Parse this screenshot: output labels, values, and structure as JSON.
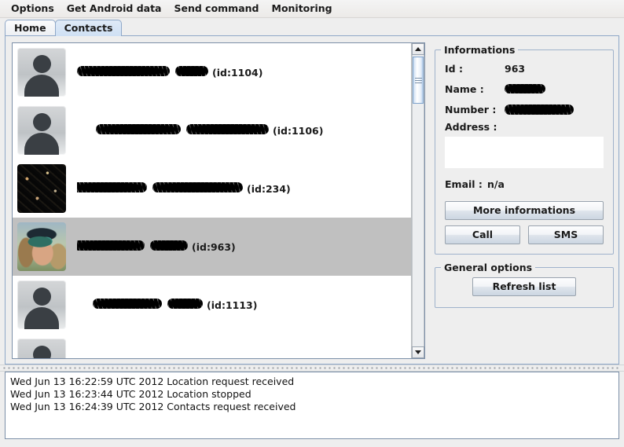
{
  "menubar": {
    "items": [
      {
        "label": "Options"
      },
      {
        "label": "Get Android data"
      },
      {
        "label": "Send command"
      },
      {
        "label": "Monitoring"
      }
    ]
  },
  "tabs": [
    {
      "label": "Home",
      "selected": false
    },
    {
      "label": "Contacts",
      "selected": true
    }
  ],
  "contacts": {
    "rows": [
      {
        "id_text": "(id:1104)",
        "avatar": "silhouette",
        "selected": false,
        "name_redacted": true,
        "redact_widths": [
          118,
          42
        ]
      },
      {
        "id_text": "(id:1106)",
        "avatar": "silhouette",
        "selected": false,
        "name_redacted": true,
        "redact_widths": [
          108,
          105
        ]
      },
      {
        "id_text": "(id:234)",
        "avatar": "redacted",
        "selected": false,
        "name_redacted": true,
        "redact_widths": [
          95,
          115
        ]
      },
      {
        "id_text": "(id:963)",
        "avatar": "photo",
        "selected": true,
        "name_redacted": true,
        "redact_widths": [
          90,
          48
        ]
      },
      {
        "id_text": "(id:1113)",
        "avatar": "silhouette",
        "selected": false,
        "name_redacted": true,
        "redact_widths": [
          88,
          45
        ]
      },
      {
        "id_text": "",
        "avatar": "silhouette",
        "selected": false,
        "name_redacted": false,
        "redact_widths": []
      }
    ],
    "scrollbar": {
      "up_arrow": "scroll-up",
      "down_arrow": "scroll-down"
    }
  },
  "informations": {
    "title": "Informations",
    "id_label": "Id :",
    "id_value": "963",
    "name_label": "Name :",
    "name_value": "",
    "number_label": "Number :",
    "number_value": "",
    "address_label": "Address :",
    "address_value": "",
    "email_label": "Email :",
    "email_value": "n/a",
    "more_button": "More informations",
    "call_button": "Call",
    "sms_button": "SMS"
  },
  "general_options": {
    "title": "General options",
    "refresh_button": "Refresh list"
  },
  "log": {
    "lines": [
      "Wed Jun 13 16:22:59 UTC 2012 Location request received",
      "Wed Jun 13 16:23:44 UTC 2012 Location stopped",
      "Wed Jun 13 16:24:39 UTC 2012 Contacts request received"
    ]
  },
  "colors": {
    "window_bg": "#eeeeee",
    "list_bg": "#ffffff",
    "selection": "#c0c0c0",
    "border": "#8fa8c8",
    "tab_selected": "#cfe0f4"
  }
}
